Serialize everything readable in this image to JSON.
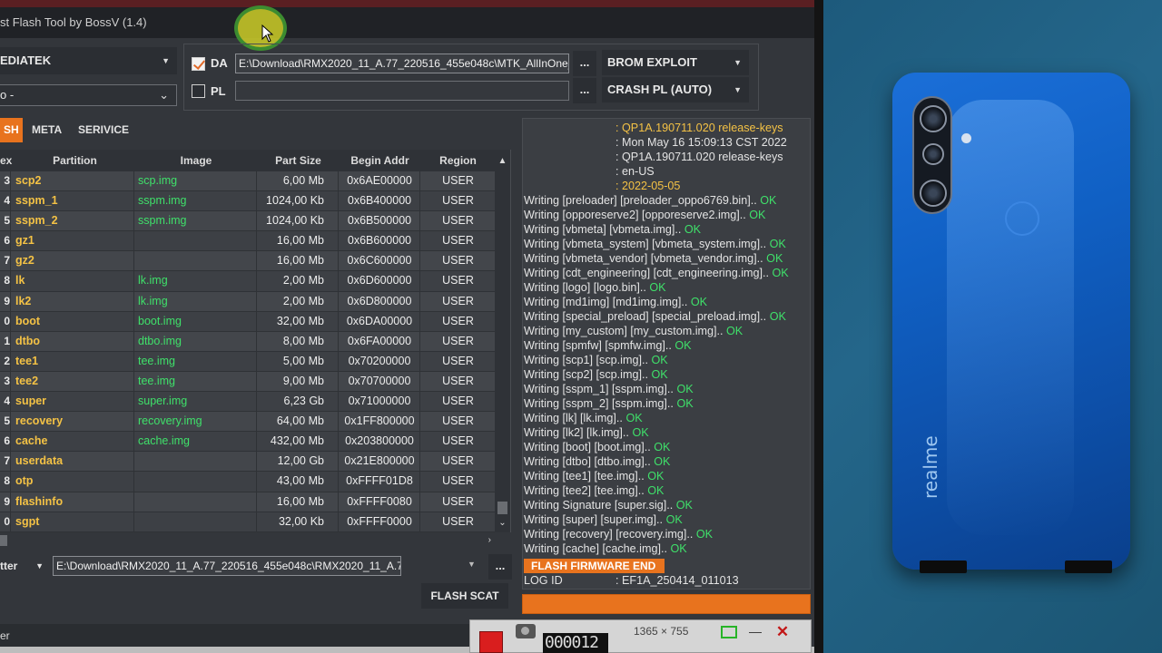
{
  "window": {
    "title": "st Flash Tool by BossV (1.4)"
  },
  "platform_select": {
    "value": "EDIATEK"
  },
  "model_select": {
    "value": "o -"
  },
  "da": {
    "label": "DA",
    "checked": true,
    "path": "E:\\Download\\RMX2020_11_A.77_220516_455e048c\\MTK_AllInOne_DA",
    "browse_label": "...",
    "mode": "BROM EXPLOIT"
  },
  "pl": {
    "label": "PL",
    "checked": false,
    "path": "",
    "browse_label": "...",
    "mode": "CRASH PL (AUTO)"
  },
  "tabs": [
    {
      "label": "SH",
      "active": true
    },
    {
      "label": "META",
      "active": false
    },
    {
      "label": "SERIVICE",
      "active": false
    }
  ],
  "table": {
    "headers": {
      "index": "ex",
      "partition": "Partition",
      "image": "Image",
      "size": "Part Size",
      "addr": "Begin Addr",
      "region": "Region"
    },
    "rows": [
      {
        "idx": "3",
        "partition": "scp2",
        "image": "scp.img",
        "size": "6,00 Mb",
        "addr": "0x6AE00000",
        "region": "USER"
      },
      {
        "idx": "4",
        "partition": "sspm_1",
        "image": "sspm.img",
        "size": "1024,00 Kb",
        "addr": "0x6B400000",
        "region": "USER"
      },
      {
        "idx": "5",
        "partition": "sspm_2",
        "image": "sspm.img",
        "size": "1024,00 Kb",
        "addr": "0x6B500000",
        "region": "USER"
      },
      {
        "idx": "6",
        "partition": "gz1",
        "image": "",
        "size": "16,00 Mb",
        "addr": "0x6B600000",
        "region": "USER"
      },
      {
        "idx": "7",
        "partition": "gz2",
        "image": "",
        "size": "16,00 Mb",
        "addr": "0x6C600000",
        "region": "USER"
      },
      {
        "idx": "8",
        "partition": "lk",
        "image": "lk.img",
        "size": "2,00 Mb",
        "addr": "0x6D600000",
        "region": "USER"
      },
      {
        "idx": "9",
        "partition": "lk2",
        "image": "lk.img",
        "size": "2,00 Mb",
        "addr": "0x6D800000",
        "region": "USER"
      },
      {
        "idx": "0",
        "partition": "boot",
        "image": "boot.img",
        "size": "32,00 Mb",
        "addr": "0x6DA00000",
        "region": "USER"
      },
      {
        "idx": "1",
        "partition": "dtbo",
        "image": "dtbo.img",
        "size": "8,00 Mb",
        "addr": "0x6FA00000",
        "region": "USER"
      },
      {
        "idx": "2",
        "partition": "tee1",
        "image": "tee.img",
        "size": "5,00 Mb",
        "addr": "0x70200000",
        "region": "USER"
      },
      {
        "idx": "3",
        "partition": "tee2",
        "image": "tee.img",
        "size": "9,00 Mb",
        "addr": "0x70700000",
        "region": "USER"
      },
      {
        "idx": "4",
        "partition": "super",
        "image": "super.img",
        "size": "6,23 Gb",
        "addr": "0x71000000",
        "region": "USER"
      },
      {
        "idx": "5",
        "partition": "recovery",
        "image": "recovery.img",
        "size": "64,00 Mb",
        "addr": "0x1FF800000",
        "region": "USER"
      },
      {
        "idx": "6",
        "partition": "cache",
        "image": "cache.img",
        "size": "432,00 Mb",
        "addr": "0x203800000",
        "region": "USER"
      },
      {
        "idx": "7",
        "partition": "userdata",
        "image": "",
        "size": "12,00 Gb",
        "addr": "0x21E800000",
        "region": "USER"
      },
      {
        "idx": "8",
        "partition": "otp",
        "image": "",
        "size": "43,00 Mb",
        "addr": "0xFFFF01D8",
        "region": "USER"
      },
      {
        "idx": "9",
        "partition": "flashinfo",
        "image": "",
        "size": "16,00 Mb",
        "addr": "0xFFFF0080",
        "region": "USER"
      },
      {
        "idx": "0",
        "partition": "sgpt",
        "image": "",
        "size": "32,00 Kb",
        "addr": "0xFFFF0000",
        "region": "USER"
      }
    ]
  },
  "scatter": {
    "label": "tter",
    "path": "E:\\Download\\RMX2020_11_A.77_220516_455e048c\\RMX2020_11_A.77_220",
    "browse_label": "...",
    "flash_button": "FLASH SCAT"
  },
  "status_bar": {
    "text": "er"
  },
  "log": {
    "info": [
      ": QP1A.190711.020 release-keys",
      ": Mon May 16 15:09:13 CST 2022",
      ": QP1A.190711.020 release-keys",
      ": en-US",
      ": 2022-05-05"
    ],
    "info_highlight": [
      true,
      false,
      false,
      false,
      true
    ],
    "lines": [
      {
        "text": "Writing [preloader] [preloader_oppo6769.bin].. ",
        "ok": "OK"
      },
      {
        "text": "Writing [opporeserve2] [opporeserve2.img].. ",
        "ok": "OK"
      },
      {
        "text": "Writing [vbmeta] [vbmeta.img].. ",
        "ok": "OK"
      },
      {
        "text": "Writing [vbmeta_system] [vbmeta_system.img].. ",
        "ok": "OK"
      },
      {
        "text": "Writing [vbmeta_vendor] [vbmeta_vendor.img].. ",
        "ok": "OK"
      },
      {
        "text": "Writing [cdt_engineering] [cdt_engineering.img].. ",
        "ok": "OK"
      },
      {
        "text": "Writing [logo] [logo.bin].. ",
        "ok": "OK"
      },
      {
        "text": "Writing [md1img] [md1img.img].. ",
        "ok": "OK"
      },
      {
        "text": "Writing [special_preload] [special_preload.img].. ",
        "ok": "OK"
      },
      {
        "text": "Writing [my_custom] [my_custom.img].. ",
        "ok": "OK"
      },
      {
        "text": "Writing [spmfw] [spmfw.img].. ",
        "ok": "OK"
      },
      {
        "text": "Writing [scp1] [scp.img].. ",
        "ok": "OK"
      },
      {
        "text": "Writing [scp2] [scp.img].. ",
        "ok": "OK"
      },
      {
        "text": "Writing [sspm_1] [sspm.img].. ",
        "ok": "OK"
      },
      {
        "text": "Writing [sspm_2] [sspm.img].. ",
        "ok": "OK"
      },
      {
        "text": "Writing [lk] [lk.img].. ",
        "ok": "OK"
      },
      {
        "text": "Writing [lk2] [lk.img].. ",
        "ok": "OK"
      },
      {
        "text": "Writing [boot] [boot.img].. ",
        "ok": "OK"
      },
      {
        "text": "Writing [dtbo] [dtbo.img].. ",
        "ok": "OK"
      },
      {
        "text": "Writing [tee1] [tee.img].. ",
        "ok": "OK"
      },
      {
        "text": "Writing [tee2] [tee.img].. ",
        "ok": "OK"
      },
      {
        "text": "Writing Signature [super.sig].. ",
        "ok": "OK"
      },
      {
        "text": "Writing [super] [super.img].. ",
        "ok": "OK"
      },
      {
        "text": "Writing [recovery] [recovery.img].. ",
        "ok": "OK"
      },
      {
        "text": "Writing [cache] [cache.img].. ",
        "ok": "OK"
      }
    ],
    "flash_end": "FLASH FIRMWARE END",
    "log_id_label": "LOG ID",
    "log_id_value": ": EF1A_250414_011013"
  },
  "progress": {
    "value": 1.0
  },
  "recorder": {
    "counter": "000012",
    "size": "1365 × 755"
  },
  "photo": {
    "brand": "realme"
  },
  "colors": {
    "accent": "#e8731e",
    "ok_green": "#3fe06a",
    "partition_yellow": "#f4c245"
  }
}
